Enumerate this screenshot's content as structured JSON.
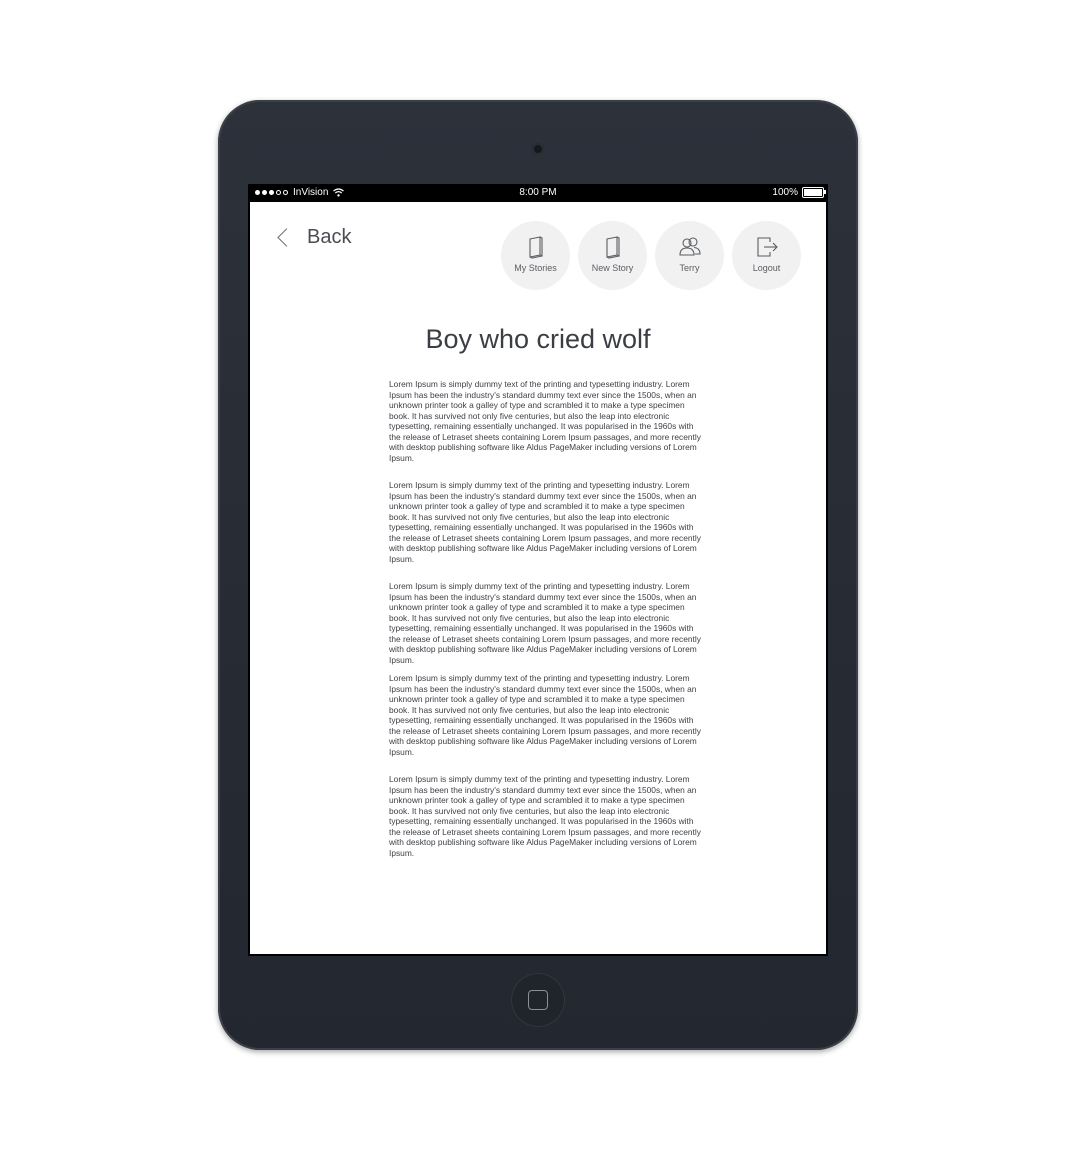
{
  "status_bar": {
    "carrier": "InVision",
    "time": "8:00 PM",
    "battery": "100%"
  },
  "back": {
    "label": "Back"
  },
  "nav": {
    "my_stories": "My Stories",
    "new_story": "New Story",
    "user": "Terry",
    "logout": "Logout"
  },
  "story": {
    "title": "Boy who cried wolf",
    "paragraphs": [
      "Lorem Ipsum is simply dummy text of the printing and typesetting industry. Lorem Ipsum has been the industry's standard dummy text ever since the 1500s, when an unknown printer took a galley of type and scrambled it to make a type specimen book. It has survived not only five centuries, but also the leap into electronic typesetting, remaining essentially unchanged. It was popularised in the 1960s with the release of Letraset sheets containing Lorem Ipsum passages, and more recently with desktop publishing software like Aldus PageMaker including versions of Lorem Ipsum.",
      "Lorem Ipsum is simply dummy text of the printing and typesetting industry. Lorem Ipsum has been the industry's standard dummy text ever since the 1500s, when an unknown printer took a galley of type and scrambled it to make a type specimen book. It has survived not only five centuries, but also the leap into electronic typesetting, remaining essentially unchanged. It was popularised in the 1960s with the release of Letraset sheets containing Lorem Ipsum passages, and more recently with desktop publishing software like Aldus PageMaker including versions of Lorem Ipsum.",
      "Lorem Ipsum is simply dummy text of the printing and typesetting industry. Lorem Ipsum has been the industry's standard dummy text ever since the 1500s, when an unknown printer took a galley of type and scrambled it to make a type specimen book. It has survived not only five centuries, but also the leap into electronic typesetting, remaining essentially unchanged. It was popularised in the 1960s with the release of Letraset sheets containing Lorem Ipsum passages, and more recently with desktop publishing software like Aldus PageMaker including versions of Lorem Ipsum.",
      "Lorem Ipsum is simply dummy text of the printing and typesetting industry. Lorem Ipsum has been the industry's standard dummy text ever since the 1500s, when an unknown printer took a galley of type and scrambled it to make a type specimen book. It has survived not only five centuries, but also the leap into electronic typesetting, remaining essentially unchanged. It was popularised in the 1960s with the release of Letraset sheets containing Lorem Ipsum passages, and more recently with desktop publishing software like Aldus PageMaker including versions of Lorem Ipsum.",
      "Lorem Ipsum is simply dummy text of the printing and typesetting industry. Lorem Ipsum has been the industry's standard dummy text ever since the 1500s, when an unknown printer took a galley of type and scrambled it to make a type specimen book. It has survived not only five centuries, but also the leap into electronic typesetting, remaining essentially unchanged. It was popularised in the 1960s with the release of Letraset sheets containing Lorem Ipsum passages, and more recently with desktop publishing software like Aldus PageMaker including versions of Lorem Ipsum."
    ]
  },
  "icons": {
    "back": "chevron-left-icon",
    "my_stories": "book-icon",
    "new_story": "book-icon",
    "user": "users-icon",
    "logout": "logout-icon"
  },
  "colors": {
    "device_body": "#2c313a",
    "screen_bg": "#ffffff",
    "nav_button_bg": "#f1f1f1",
    "text": "#3b3e43"
  }
}
